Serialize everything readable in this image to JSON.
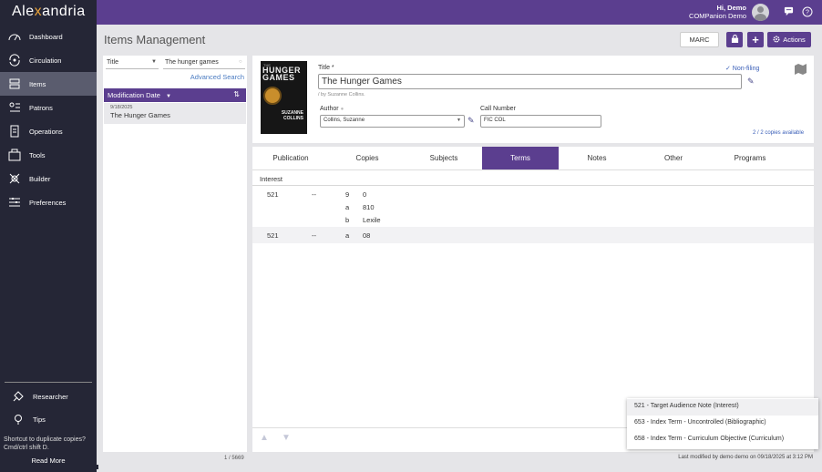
{
  "app": {
    "logo_part1": "Ale",
    "logo_x": "x",
    "logo_part2": "andria"
  },
  "header": {
    "greeting_line1": "Hi, Demo",
    "greeting_line2": "COMPanion Demo",
    "messages_icon": "chat-icon",
    "help_icon": "help-icon"
  },
  "sidebar": {
    "items": [
      {
        "label": "Dashboard",
        "icon": "dashboard-icon"
      },
      {
        "label": "Circulation",
        "icon": "circulation-icon"
      },
      {
        "label": "Items",
        "icon": "items-icon",
        "active": true
      },
      {
        "label": "Patrons",
        "icon": "patrons-icon"
      },
      {
        "label": "Operations",
        "icon": "operations-icon"
      },
      {
        "label": "Tools",
        "icon": "tools-icon"
      },
      {
        "label": "Builder",
        "icon": "builder-icon"
      },
      {
        "label": "Preferences",
        "icon": "preferences-icon"
      }
    ],
    "bottom_items": [
      {
        "label": "Researcher",
        "icon": "researcher-icon"
      },
      {
        "label": "Tips",
        "icon": "lightbulb-icon"
      }
    ],
    "tip_text": "Shortcut to duplicate copies? Cmd/ctrl shift D.",
    "read_more": "Read More"
  },
  "page": {
    "title": "Items Management",
    "marc_label": "MARC",
    "actions_label": "Actions"
  },
  "search": {
    "field": "Title",
    "query": "The hunger games",
    "advanced": "Advanced Search",
    "sort_label": "Modification Date",
    "record_date": "9/18/2025",
    "record_title": "The Hunger Games",
    "count": "1 / 5669"
  },
  "item": {
    "cover_small": "THE",
    "cover_title": "HUNGER GAMES",
    "cover_author": "SUZANNE COLLINS",
    "title_label": "Title *",
    "title_value": "The Hunger Games",
    "statement": "/ by Suzanne Collins.",
    "author_label": "Author",
    "author_value": "Collins, Suzanne",
    "call_label": "Call Number",
    "call_value": "FIC COL",
    "nonfiling": "✓ Non-filing",
    "copies": "2 / 2 copies available"
  },
  "tabs": [
    "Publication",
    "Copies",
    "Subjects",
    "Terms",
    "Notes",
    "Other",
    "Programs"
  ],
  "active_tab": "Terms",
  "terms": {
    "section": "Interest",
    "rows": [
      {
        "tag": "521",
        "ind": "--",
        "subs": [
          [
            "9",
            "0"
          ],
          [
            "a",
            "810"
          ],
          [
            "b",
            "Lexile"
          ]
        ]
      },
      {
        "tag": "521",
        "ind": "--",
        "subs": [
          [
            "a",
            "08"
          ]
        ]
      }
    ]
  },
  "popup": {
    "items": [
      "521 - Target Audience Note (Interest)",
      "653 - Index Term - Uncontrolled (Bibliographic)",
      "658 - Index Term - Curriculum Objective (Curriculum)"
    ]
  },
  "footer": {
    "modified": "Last modified by demo demo on 09/18/2025 at 3:12 PM"
  },
  "colors": {
    "accent": "#5b3e8f",
    "sidebar": "#252636",
    "link": "#3a5fb8"
  }
}
